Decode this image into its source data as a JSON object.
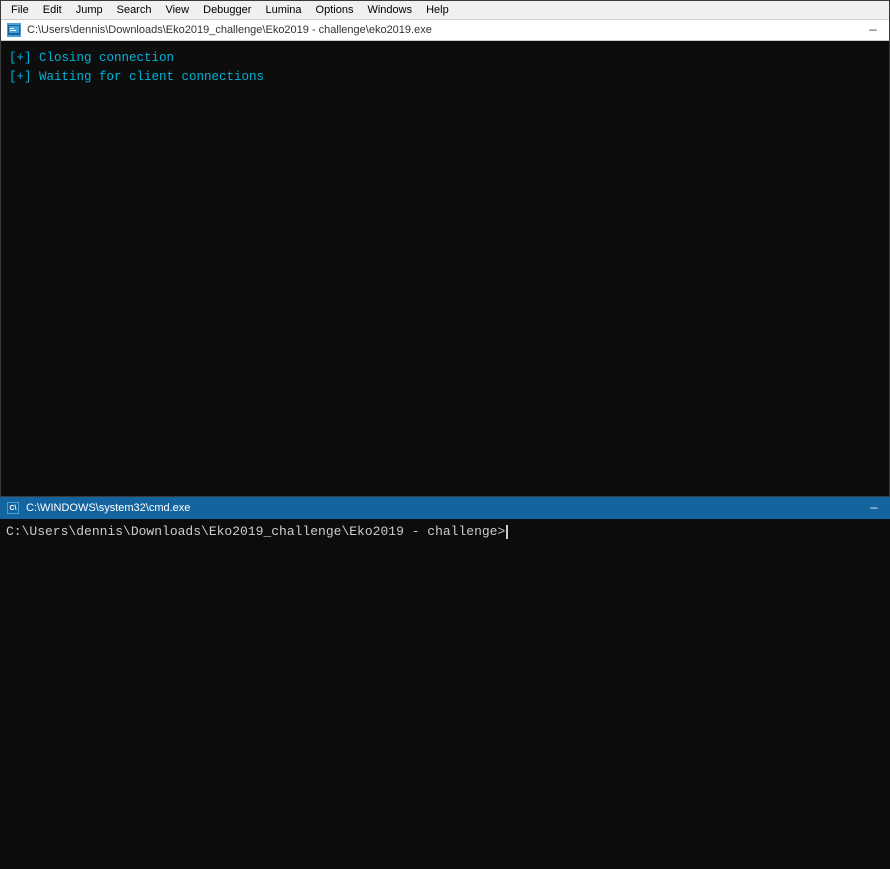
{
  "top_window": {
    "menu": {
      "items": [
        "File",
        "Edit",
        "Jump",
        "Search",
        "View",
        "Debugger",
        "Lumina",
        "Options",
        "Windows",
        "Help"
      ]
    },
    "title_bar": {
      "icon_label": "D",
      "path": "C:\\Users\\dennis\\Downloads\\Eko2019_challenge\\Eko2019 - challenge\\eko2019.exe",
      "minimize_label": "—"
    },
    "console": {
      "lines": [
        "[+] Closing connection",
        "[+] Waiting for client connections"
      ]
    }
  },
  "bottom_window": {
    "title_bar": {
      "icon_label": "C:\\",
      "path": "C:\\WINDOWS\\system32\\cmd.exe",
      "minimize_label": "—"
    },
    "console": {
      "prompt": "C:\\Users\\dennis\\Downloads\\Eko2019_challenge\\Eko2019 - challenge>"
    }
  }
}
